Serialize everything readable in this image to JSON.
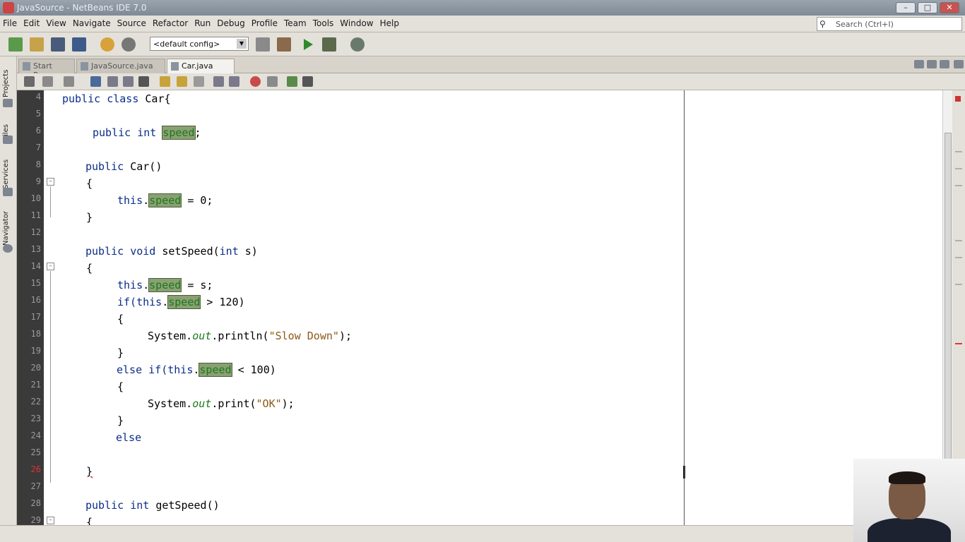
{
  "window": {
    "title": "JavaSource - NetBeans IDE 7.0"
  },
  "menu": {
    "items": [
      "File",
      "Edit",
      "View",
      "Navigate",
      "Source",
      "Refactor",
      "Run",
      "Debug",
      "Profile",
      "Team",
      "Tools",
      "Window",
      "Help"
    ],
    "search_placeholder": "Search (Ctrl+I)"
  },
  "toolbar": {
    "config_value": "<default config>"
  },
  "side_tabs": [
    "Projects",
    "Files",
    "Services",
    "Navigator"
  ],
  "editor_tabs": [
    {
      "label": "Start Page",
      "active": false
    },
    {
      "label": "JavaSource.java",
      "active": false
    },
    {
      "label": "Car.java",
      "active": true
    }
  ],
  "editor": {
    "line_numbers": [
      "4",
      "5",
      "6",
      "7",
      "8",
      "9",
      "10",
      "11",
      "12",
      "13",
      "14",
      "15",
      "16",
      "17",
      "18",
      "19",
      "20",
      "21",
      "22",
      "23",
      "24",
      "25",
      "26",
      "27",
      "28",
      "29"
    ],
    "code": {
      "l4_a": "public class",
      "l4_b": " Car{",
      "l6_a": "public int",
      "l6_f": "speed",
      "l6_b": ";",
      "l8_a": "public",
      "l8_b": " Car()",
      "l9": "{",
      "l10_a": "this",
      "l10_b": ".",
      "l10_f": "speed",
      "l10_c": " = 0;",
      "l11": "}",
      "l13_a": "public void",
      "l13_b": " setSpeed(",
      "l13_c": "int",
      "l13_d": " s)",
      "l14": "{",
      "l15_a": "this",
      "l15_b": ".",
      "l15_f": "speed",
      "l15_c": " = s;",
      "l16_a": "if(",
      "l16_b": "this",
      "l16_c": ".",
      "l16_f": "speed",
      "l16_d": " > 120)",
      "l17": "{",
      "l18_a": "System.",
      "l18_b": "out",
      "l18_c": ".println(",
      "l18_s": "\"Slow Down\"",
      "l18_d": ");",
      "l19": "}",
      "l20_a": "else if(",
      "l20_b": "this",
      "l20_c": ".",
      "l20_f": "speed",
      "l20_d": " < 100)",
      "l21": "{",
      "l22_a": "System.",
      "l22_b": "out",
      "l22_c": ".print(",
      "l22_s": "\"OK\"",
      "l22_d": ");",
      "l23": "}",
      "l24": "else",
      "l26": "}",
      "l28_a": "public int",
      "l28_b": " getSpeed()",
      "l29": "{"
    }
  },
  "colors": {
    "keyword": "#0b2d8b",
    "field_highlight": "#8aa073",
    "string": "#8a5a18",
    "gutter": "#3a3a3a"
  }
}
